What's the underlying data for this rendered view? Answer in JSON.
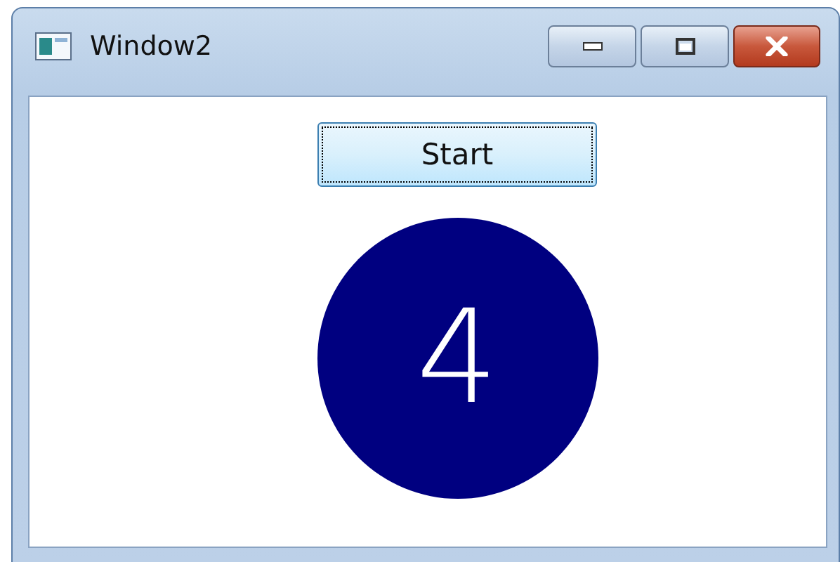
{
  "window": {
    "title": "Window2"
  },
  "start_button": {
    "label": "Start",
    "focused": true
  },
  "counter": {
    "value": "4"
  }
}
